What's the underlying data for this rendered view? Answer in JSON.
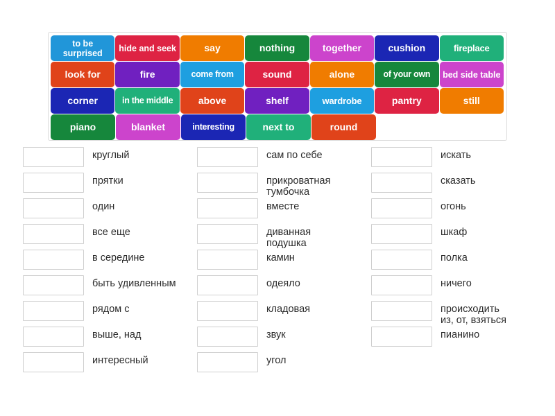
{
  "tile_bank": {
    "name": "word-tile-bank",
    "rows": [
      [
        {
          "label": "to be surprised",
          "color": "#2196d9",
          "style": "two-line"
        },
        {
          "label": "hide and seek",
          "color": "#de2343",
          "style": "two-line"
        },
        {
          "label": "say",
          "color": "#f07c00",
          "style": "normal"
        },
        {
          "label": "nothing",
          "color": "#16873c",
          "style": "normal"
        },
        {
          "label": "together",
          "color": "#cc44cc",
          "style": "normal"
        },
        {
          "label": "cushion",
          "color": "#1b26b4",
          "style": "normal"
        },
        {
          "label": "fireplace",
          "color": "#20b07a",
          "style": "squeeze"
        }
      ],
      [
        {
          "label": "look for",
          "color": "#e0431a",
          "style": "normal"
        },
        {
          "label": "fire",
          "color": "#7020c0",
          "style": "normal"
        },
        {
          "label": "come from",
          "color": "#1e9fe0",
          "style": "squeeze2"
        },
        {
          "label": "sound",
          "color": "#de2343",
          "style": "normal"
        },
        {
          "label": "alone",
          "color": "#f07c00",
          "style": "normal"
        },
        {
          "label": "of your own",
          "color": "#16873c",
          "style": "squeeze2"
        },
        {
          "label": "bed side table",
          "color": "#cc44cc",
          "style": "two-line"
        }
      ],
      [
        {
          "label": "corner",
          "color": "#1b26b4",
          "style": "normal"
        },
        {
          "label": "in the middle",
          "color": "#20b07a",
          "style": "squeeze2"
        },
        {
          "label": "above",
          "color": "#e0431a",
          "style": "normal"
        },
        {
          "label": "shelf",
          "color": "#7020c0",
          "style": "normal"
        },
        {
          "label": "wardrobe",
          "color": "#1e9fe0",
          "style": "squeeze"
        },
        {
          "label": "pantry",
          "color": "#de2343",
          "style": "normal"
        },
        {
          "label": "still",
          "color": "#f07c00",
          "style": "normal"
        }
      ],
      [
        {
          "label": "piano",
          "color": "#16873c",
          "style": "normal"
        },
        {
          "label": "blanket",
          "color": "#cc44cc",
          "style": "normal"
        },
        {
          "label": "interesting",
          "color": "#1b26b4",
          "style": "squeeze2"
        },
        {
          "label": "next to",
          "color": "#20b07a",
          "style": "normal"
        },
        {
          "label": "round",
          "color": "#e0431a",
          "style": "normal"
        }
      ]
    ]
  },
  "answers": {
    "columns": [
      {
        "name": "answer-column-1",
        "rows": [
          {
            "label": "круглый",
            "value": ""
          },
          {
            "label": "прятки",
            "value": ""
          },
          {
            "label": "один",
            "value": ""
          },
          {
            "label": "все еще",
            "value": ""
          },
          {
            "label": "в середине",
            "value": ""
          },
          {
            "label": "быть удивленным",
            "value": ""
          },
          {
            "label": "рядом с",
            "value": ""
          },
          {
            "label": "выше, над",
            "value": ""
          },
          {
            "label": "интересный",
            "value": ""
          }
        ]
      },
      {
        "name": "answer-column-2",
        "rows": [
          {
            "label": "сам по себе",
            "value": ""
          },
          {
            "label": "прикроватная\nтумбочка",
            "value": ""
          },
          {
            "label": "вместе",
            "value": ""
          },
          {
            "label": "диванная\nподушка",
            "value": ""
          },
          {
            "label": "камин",
            "value": ""
          },
          {
            "label": "одеяло",
            "value": ""
          },
          {
            "label": "кладовая",
            "value": ""
          },
          {
            "label": "звук",
            "value": ""
          },
          {
            "label": "угол",
            "value": ""
          }
        ]
      },
      {
        "name": "answer-column-3",
        "rows": [
          {
            "label": "искать",
            "value": ""
          },
          {
            "label": "сказать",
            "value": ""
          },
          {
            "label": "огонь",
            "value": ""
          },
          {
            "label": "шкаф",
            "value": ""
          },
          {
            "label": "полка",
            "value": ""
          },
          {
            "label": "ничего",
            "value": ""
          },
          {
            "label": "происходить\nиз, от, взяться",
            "value": ""
          },
          {
            "label": "пианино",
            "value": ""
          }
        ]
      }
    ]
  }
}
